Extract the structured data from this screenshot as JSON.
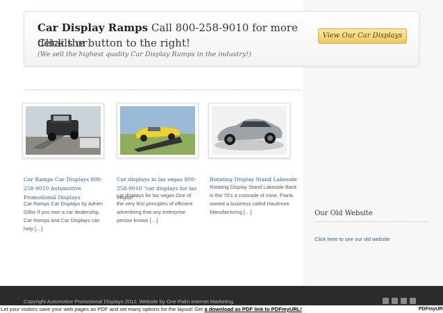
{
  "header": {
    "title_bold": "Car Display Ramps",
    "title_rest": " Call 800-258-9010 for more details or",
    "line2": "Click the button to the right!",
    "subtitle": "(We sell the highest quality Car Display Ramps in the industry!)",
    "cta_label": "View Our Car Displays"
  },
  "posts": [
    {
      "title": "Car Ramps Car Displays 800-258-9010 Automotive Promotional Displays",
      "excerpt": "Car Ramps Car Displays by Adrien Gilbo If you own a car dealership, Car Ramps and Car Displays can help […]"
    },
    {
      "title": "Car displays in las vegas 800-258-9010 \"car displays for las vegas\"",
      "excerpt": " car displays for las vegas One of the very first principles of efficient advertising that any enterprise person knows […]"
    },
    {
      "title": "Rotating Display Stand Lakeside",
      "excerpt": " Rotating Display Stand Lakeside Back in the 70's a comrade of mine, Frank, owned a business called Haulmore Manufacturing […]"
    }
  ],
  "sidebar": {
    "widget_title": "Our Old Website",
    "link_text": "Click here to see our old website"
  },
  "footer": {
    "copyright": "Copyright Automotive Promotional Displays 2012. Website by One Palm Internet Marketing.",
    "social_icons": [
      "rss-icon",
      "email-icon",
      "twitter-icon",
      "facebook-icon"
    ]
  },
  "pdf_bar": {
    "text": "Let your visitors save your web pages as PDF and set many options for the layout! Get ",
    "link": "a download as PDF link to PDFmyURL!",
    "logo": "PDFmyURL"
  },
  "colors": {
    "accent_link": "#2b5c9b",
    "cta_bg": "#f0c860",
    "footer_bg": "#2b2b2b"
  }
}
